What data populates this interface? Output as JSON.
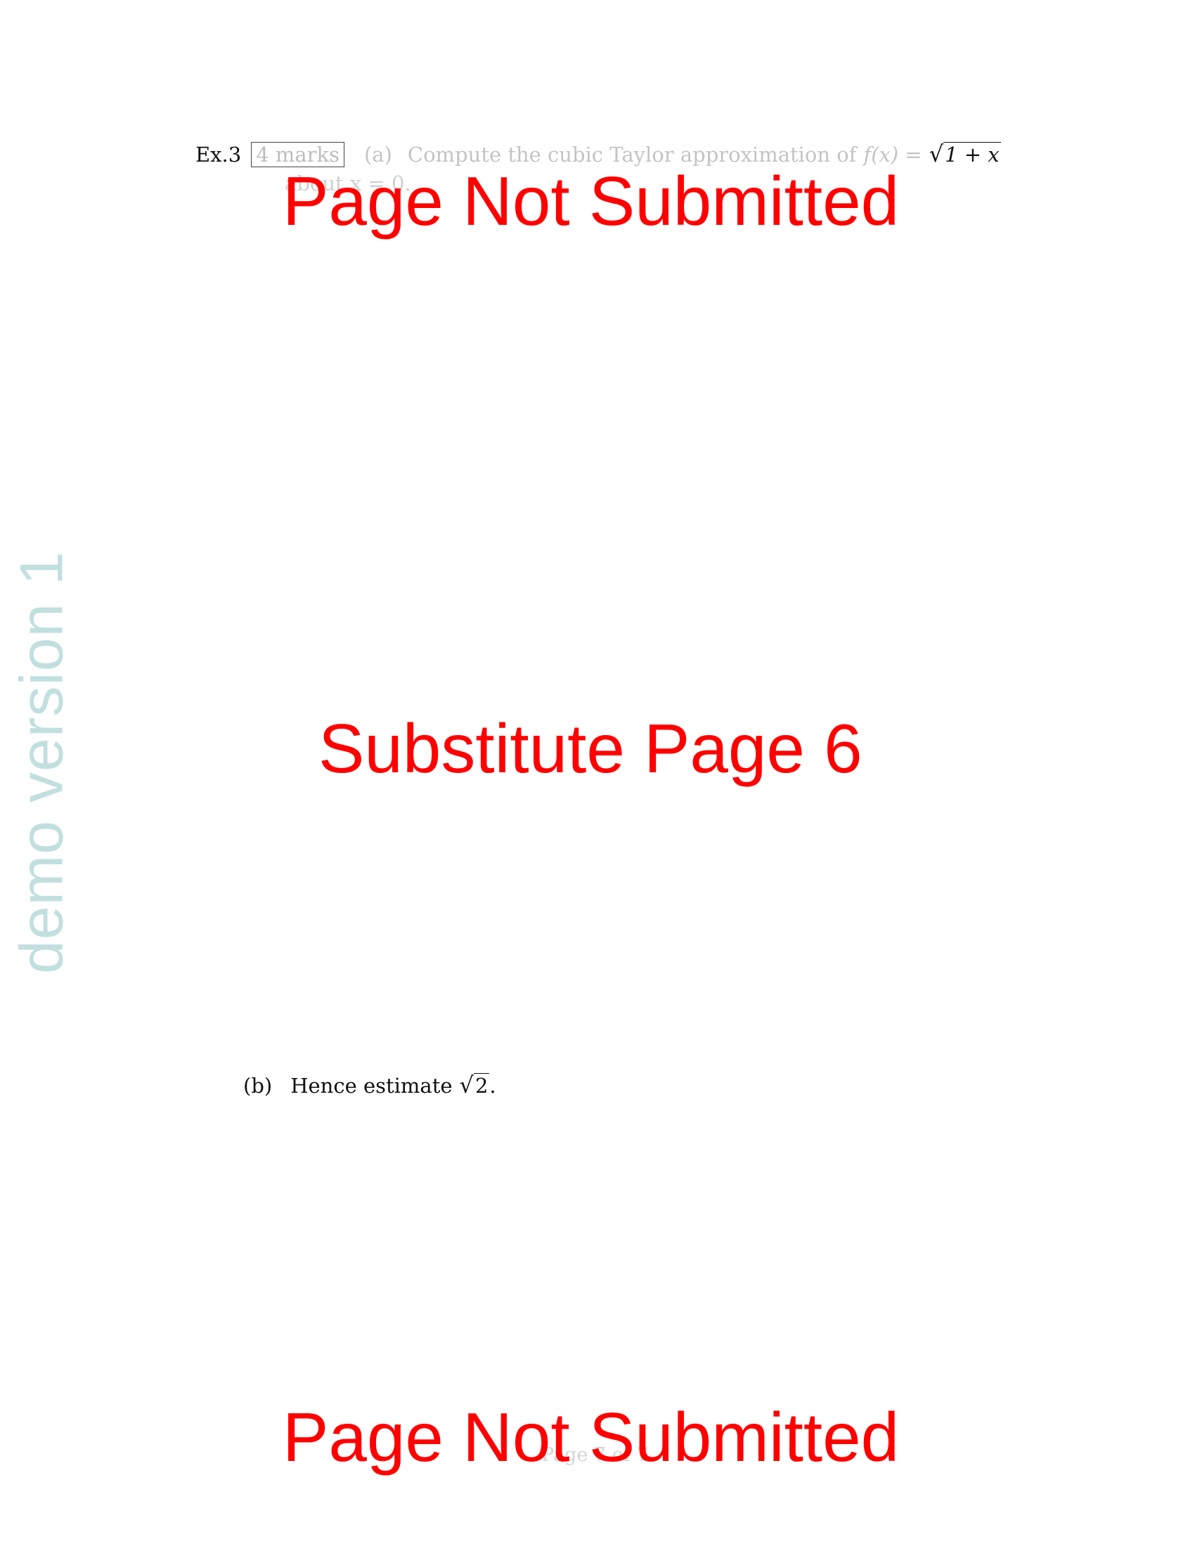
{
  "watermark": "demo version 1",
  "question": {
    "label": "Ex.3",
    "marks": "4 marks",
    "part_a": {
      "label": "(a)",
      "text": "Compute the cubic Taylor approximation of",
      "function": "f(x) =",
      "sqrt_radicand": "1 + x",
      "about": "about x = 0."
    },
    "part_b": {
      "label": "(b)",
      "text": "Hence estimate",
      "sqrt_radicand": "2",
      "end": "."
    }
  },
  "stamps": {
    "top": "Page Not Submitted",
    "middle": "Substitute Page 6",
    "bottom": "Page Not Submitted"
  },
  "footer": "Page 7 of 7",
  "colors": {
    "stamp": "#ff0000",
    "watermark": "#c2dfe0",
    "faded_text": "#c4c4c4"
  }
}
